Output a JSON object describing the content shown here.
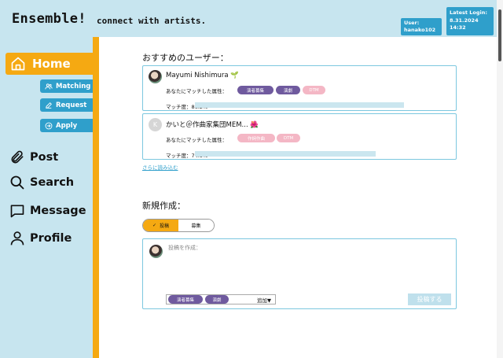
{
  "app": {
    "title": "Ensemble!",
    "tagline": "connect with artists.",
    "user_label": "User:",
    "username": "hanako102",
    "login_label": "Latest Login:",
    "login_date": "8.31.2024",
    "login_time": "14:32"
  },
  "sidebar": {
    "home": "Home",
    "sub_items": [
      "Matching",
      "Request",
      "Apply"
    ],
    "items": [
      "Post",
      "Search",
      "Message",
      "Profile"
    ]
  },
  "recommended": {
    "title": "おすすめのユーザー：",
    "users": [
      {
        "name": "Mayumi Nishimura 🌱",
        "attr_label": "あなたにマッチした属性：",
        "tags": [
          "演者募集",
          "演劇",
          "DTM"
        ],
        "match_label": "マッチ度：86.2%",
        "match_value": 86.2
      },
      {
        "avatar_letter": "K",
        "name": "かいと＠作曲家集団MEM... 🌺",
        "attr_label": "あなたにマッチした属性：",
        "tags": [
          "作詞作曲",
          "DTM"
        ],
        "match_label": "マッチ度：74.5%",
        "match_value": 74.5
      }
    ],
    "read_more": "さらに読み込む"
  },
  "create": {
    "title": "新規作成：",
    "toggle_post": "投稿",
    "toggle_recruit": "募集",
    "toggle_check": "✓",
    "placeholder": "投稿を作成：",
    "tags": [
      "演者募集",
      "演劇"
    ],
    "add_label": "追加▼",
    "submit": "投稿する"
  },
  "colors": {
    "accent": "#f5a912",
    "primary": "#2f9fcb",
    "panel": "#c7e5ef",
    "tag_dark": "#6f5a9e",
    "tag_pink": "#f4b7c5"
  }
}
